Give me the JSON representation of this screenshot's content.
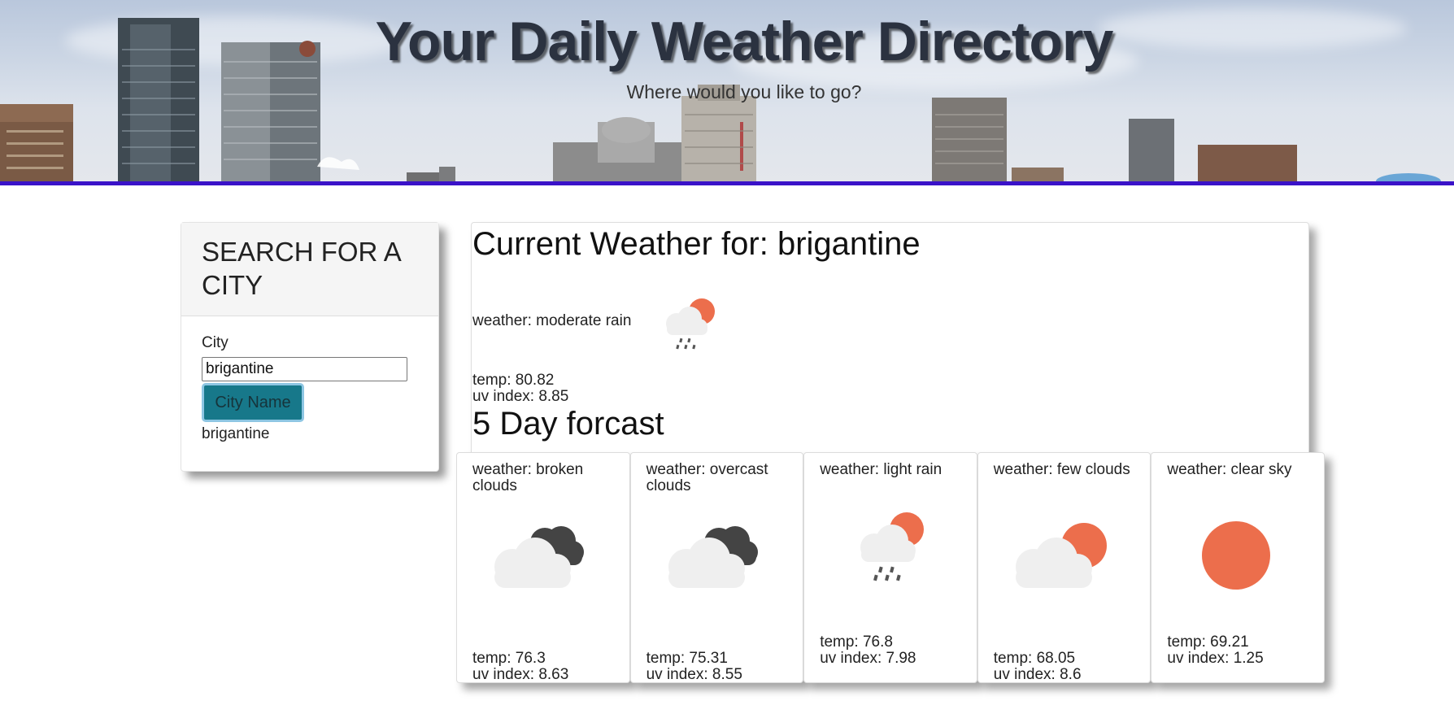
{
  "header": {
    "title": "Your Daily Weather Directory",
    "subtitle": "Where would you like to go?",
    "accent_color": "#3a12c8"
  },
  "search": {
    "heading": "SEARCH FOR A CITY",
    "city_label": "City",
    "city_value": "brigantine",
    "button_label": "City Name",
    "history": [
      "brigantine"
    ]
  },
  "current": {
    "title": "Current Weather for: brigantine",
    "weather": "weather: moderate rain",
    "icon": "rain-sun-icon",
    "temp": "temp: 80.82",
    "uv": "uv index: 8.85"
  },
  "forecast": {
    "title": "5 Day forcast",
    "days": [
      {
        "weather": "weather: broken clouds",
        "icon": "broken-clouds-icon",
        "temp": "temp: 76.3",
        "uv": "uv index: 8.63"
      },
      {
        "weather": "weather: overcast clouds",
        "icon": "broken-clouds-icon",
        "temp": "temp: 75.31",
        "uv": "uv index: 8.55"
      },
      {
        "weather": "weather: light rain",
        "icon": "rain-sun-icon",
        "temp": "temp: 76.8",
        "uv": "uv index: 7.98"
      },
      {
        "weather": "weather: few clouds",
        "icon": "few-clouds-icon",
        "temp": "temp: 68.05",
        "uv": "uv index: 8.6"
      },
      {
        "weather": "weather: clear sky",
        "icon": "clear-sky-icon",
        "temp": "temp: 69.21",
        "uv": "uv index: 1.25"
      }
    ]
  },
  "colors": {
    "sun": "#ec6e4c",
    "cloud_light": "#efefef",
    "cloud_dark": "#444444",
    "button_bg": "#17788a"
  }
}
